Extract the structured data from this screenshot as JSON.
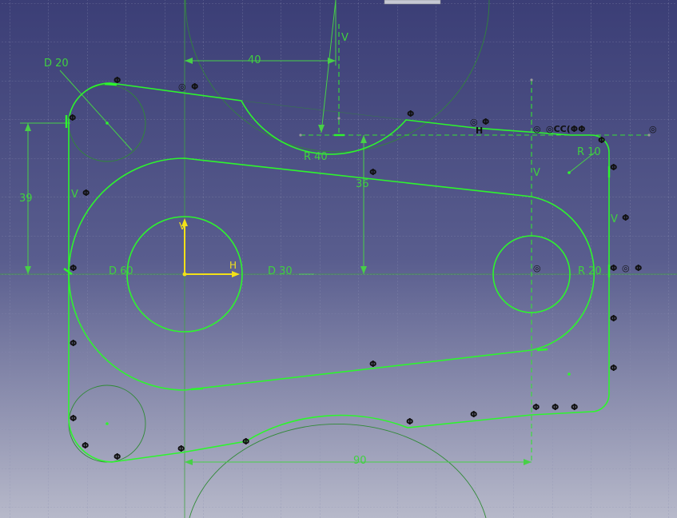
{
  "app": {
    "context": "sketch-workspace",
    "colors": {
      "background_top": "#393d73",
      "background_bottom": "#b6b8c9",
      "geometry": "#2dfa2d",
      "construction": "#3aa53a",
      "dimension": "#44d744",
      "axis": "#f2e117",
      "constraint_symbol": "#141414"
    }
  },
  "dimensions": {
    "d20": "D 20",
    "d60": "D 60",
    "d30": "D 30",
    "r40": "R 40",
    "r10": "R 10",
    "r20": "R 20",
    "len40": "40",
    "len39": "39",
    "len36": "36",
    "len90": "90"
  },
  "axes": {
    "h_label": "H",
    "v_label": "V"
  },
  "constraints": {
    "v_label": "V",
    "tangent": "Φ",
    "concentric": "◎",
    "coincident": "◎",
    "horizontal": "H",
    "cluster_label": "◎CC(ΦΦ"
  },
  "toolbar_fragment": {
    "visible": true
  }
}
